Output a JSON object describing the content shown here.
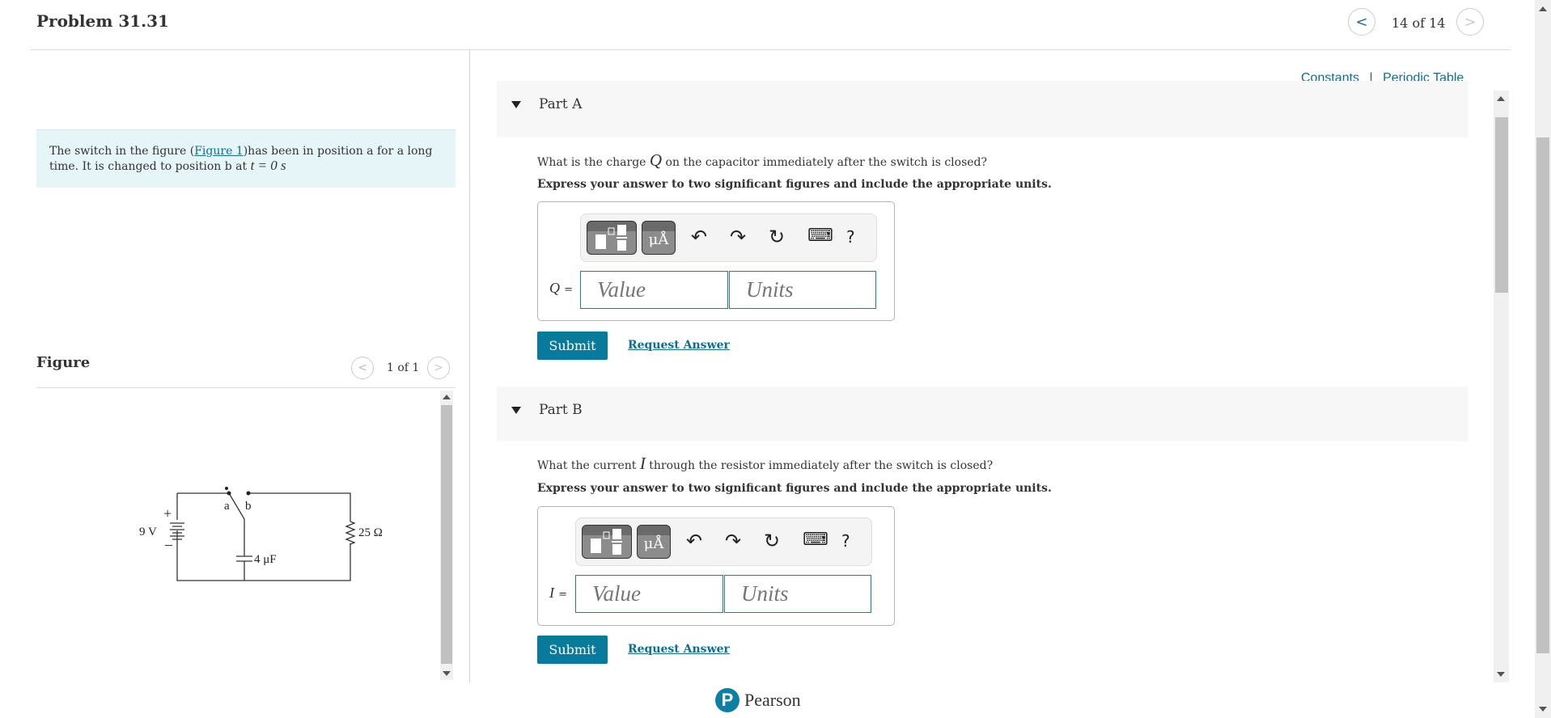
{
  "header": {
    "title": "Problem 31.31",
    "prev_icon": "chevron-left-icon",
    "next_icon": "chevron-right-icon",
    "prev": "<",
    "next": ">",
    "position": "14 of 14"
  },
  "intro": {
    "before": "The switch in the figure (",
    "link": "Figure 1",
    "after": ")has been in position a for a long time. It is changed to position b at ",
    "math": "t = 0 s",
    "end": "."
  },
  "figure": {
    "label": "Figure",
    "position": "1 of 1",
    "prev": "<",
    "next": ">",
    "circuit": {
      "switch_a": "a",
      "switch_b": "b",
      "battery": "9 V",
      "plus": "+",
      "minus": "–",
      "resistor": "25 Ω",
      "capacitor": "4 μF"
    }
  },
  "links": {
    "constants": "Constants",
    "sep": "|",
    "periodic_table": "Periodic Table"
  },
  "parts": [
    {
      "label": "Part A",
      "question_before": "What is the charge ",
      "var": "Q",
      "question_after": " on the capacitor immediately after the switch is closed?",
      "instruction": "Express your answer to two significant figures and include the appropriate units.",
      "value_placeholder": "Value",
      "units_placeholder": "Units",
      "submit": "Submit",
      "request": "Request Answer"
    },
    {
      "label": "Part B",
      "question_before": "What the current ",
      "var": "I",
      "question_after": " through the resistor immediately after the switch is closed?",
      "instruction": "Express your answer to two significant figures and include the appropriate units.",
      "value_placeholder": "Value",
      "units_placeholder": "Units",
      "submit": "Submit",
      "request": "Request Answer"
    }
  ],
  "toolbar": {
    "units_btn": "μÅ",
    "undo": "↶",
    "redo": "↷",
    "reset": "↻",
    "keyboard": "⌨",
    "help": "?",
    "equals": "="
  },
  "footer": {
    "brand": "Pearson",
    "logo_letter": "P"
  },
  "colors": {
    "accent": "#087a9c",
    "intro_bg": "#e6f5f7",
    "part_bar": "#f7f7f7"
  }
}
